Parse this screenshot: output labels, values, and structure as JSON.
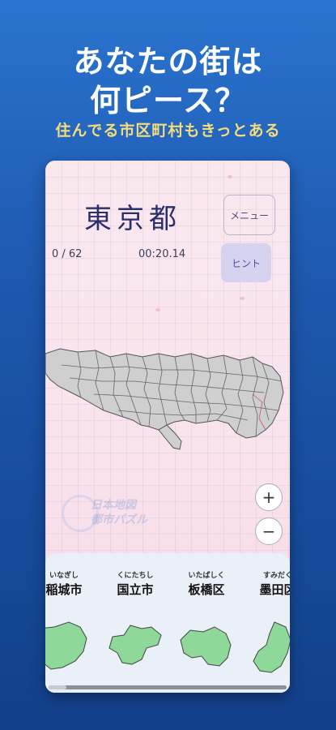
{
  "hero": {
    "title_line1": "あなたの街は",
    "title_line2": "何ピース？",
    "subtitle": "住んでる市区町村もきっとある"
  },
  "game": {
    "prefecture": "東京都",
    "menu_label": "メニュー",
    "hint_label": "ヒント",
    "progress": "0 / 62",
    "timer": "00:20.14",
    "watermark_line1": "日本地図",
    "watermark_line2": "都市パズル",
    "zoom_in": "+",
    "zoom_out": "−"
  },
  "pieces": [
    {
      "ruby": "いなぎし",
      "name": "稲城市"
    },
    {
      "ruby": "くにたちし",
      "name": "国立市"
    },
    {
      "ruby": "いたばしく",
      "name": "板橋区"
    },
    {
      "ruby": "すみだく",
      "name": "墨田区"
    }
  ],
  "colors": {
    "background_top": "#2a74cf",
    "subtitle": "#f5dc7a",
    "piece_fill": "#8ed89a",
    "map_fill": "#cfcfcf"
  }
}
